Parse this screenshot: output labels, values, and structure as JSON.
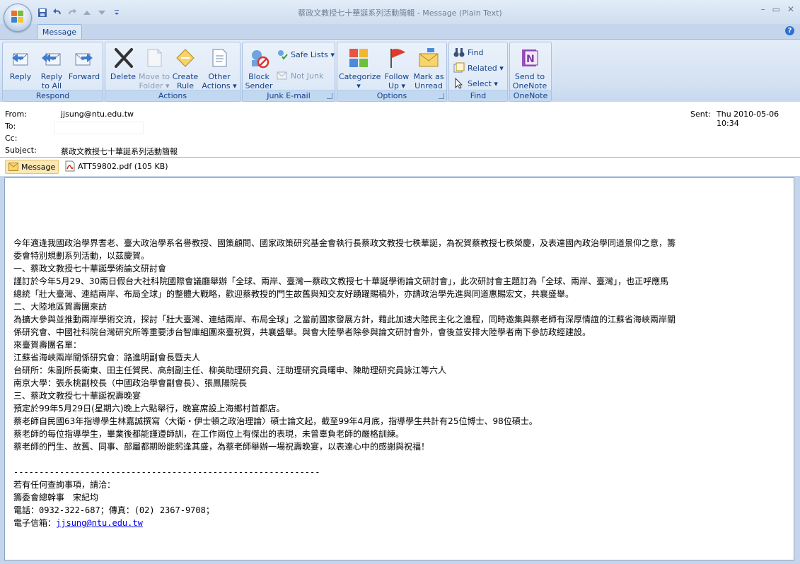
{
  "window": {
    "title": "蔡政文教授七十華誕系列活動簡輯 - Message (Plain Text)",
    "controls": [
      "–",
      "▭",
      "✕"
    ]
  },
  "ribbon": {
    "tab": "Message",
    "groups": {
      "respond": {
        "label": "Respond",
        "reply": "Reply",
        "reply_all": [
          "Reply",
          "to All"
        ],
        "forward": "Forward"
      },
      "actions": {
        "label": "Actions",
        "delete": "Delete",
        "move": [
          "Move to",
          "Folder ▾"
        ],
        "create_rule": [
          "Create",
          "Rule"
        ],
        "other": [
          "Other",
          "Actions ▾"
        ]
      },
      "junk": {
        "label": "Junk E-mail",
        "block": [
          "Block",
          "Sender"
        ],
        "safe_lists": "Safe Lists ▾",
        "not_junk": "Not Junk"
      },
      "options": {
        "label": "Options",
        "categorize": [
          "Categorize",
          "▾"
        ],
        "follow_up": [
          "Follow",
          "Up ▾"
        ],
        "mark_unread": [
          "Mark as",
          "Unread"
        ]
      },
      "find": {
        "label": "Find",
        "find": "Find",
        "related": "Related ▾",
        "select": "Select ▾"
      },
      "onenote": {
        "label": "OneNote",
        "send": [
          "Send to",
          "OneNote"
        ]
      }
    }
  },
  "header": {
    "from_label": "From:",
    "from": "jjsung@ntu.edu.tw",
    "to_label": "To:",
    "cc_label": "Cc:",
    "subject_label": "Subject:",
    "subject": "蔡政文教授七十華誕系列活動簡報",
    "sent_label": "Sent:",
    "sent": "Thu 2010-05-06 10:34"
  },
  "attachments": {
    "message": "Message",
    "file": "ATT59802.pdf (105 KB)"
  },
  "body": {
    "lines": [
      "今年適逢我國政治學界耆老、臺大政治學系名譽教授、國策顧問、國家政策研究基金會執行長蔡政文教授七秩華誕，為祝賀蔡教授七秩榮慶，及表達國內政治學同道景仰之意，籌",
      "委會特別規劃系列活動，以茲慶賀。",
      "一、蔡政文教授七十華誕學術論文研討會",
      "謹訂於今年5月29、30兩日假台大社科院國際會議廳舉辦「全球、兩岸、臺灣—蔡政文教授七十華誕學術論文研討會」，此次研討會主題訂為「全球、兩岸、臺灣」，也正呼應馬",
      "總統「壯大臺灣、連結兩岸、布局全球」的整體大戰略，歡迎蔡教授的門生故舊與知交友好踴躍賜稿外，亦請政治學先進與同道惠賜宏文，共襄盛舉。",
      "二、大陸地區賀壽團來訪",
      "為擴大參與並推動兩岸學術交流，探討「壯大臺灣、連結兩岸、布局全球」之當前國家發展方針，藉此加速大陸民主化之進程，同時邀集與蔡老師有深厚情誼的江蘇省海峽兩岸關",
      "係研究會、中國社科院台灣研究所等重要涉台智庫組團來臺祝賀，共襄盛舉。與會大陸學者除參與論文研討會外，會後並安排大陸學者南下參訪政經建設。",
      "來臺賀壽團名單：",
      "江蘇省海峽兩岸關係研究會：路進明副會長暨夫人",
      "台研所：朱副所長衛東、田主任賀民、高劍副主任、柳英助理研究員、汪助理研究員曙申、陳助理研究員詠江等六人",
      "南京大學：張永桃副校長（中國政治學會副會長）、張鳳陽院長",
      "三、蔡政文教授七十華誕祝壽晚宴",
      "預定於99年5月29日(星期六)晚上六點舉行，晚宴席設上海鄉村首都店。",
      "蔡老師自民國63年指導學生林嘉誠撰寫〈大衛・伊士頓之政治理論〉碩士論文起，截至99年4月底，指導學生共計有25位博士、98位碩士。",
      "蔡老師的每位指導學生，畢業後都能謹遵師訓，在工作崗位上有傑出的表現，未曾辜負老師的嚴格訓練。",
      "蔡老師的門生、故舊、同事、部屬都期盼能躬逢其盛，為蔡老師舉辦一場祝壽晚宴，以表達心中的感謝與祝福！"
    ],
    "divider": "------------------------------------------------------------",
    "contact_intro": "若有任何查詢事項，請洽：",
    "contact_person": "籌委會總幹事　宋紀均",
    "contact_phone": "電話：0932-322-687；傳真：(02) 2367-9708；",
    "contact_email_label": "電子信箱：",
    "contact_email": "jjsung@ntu.edu.tw"
  }
}
